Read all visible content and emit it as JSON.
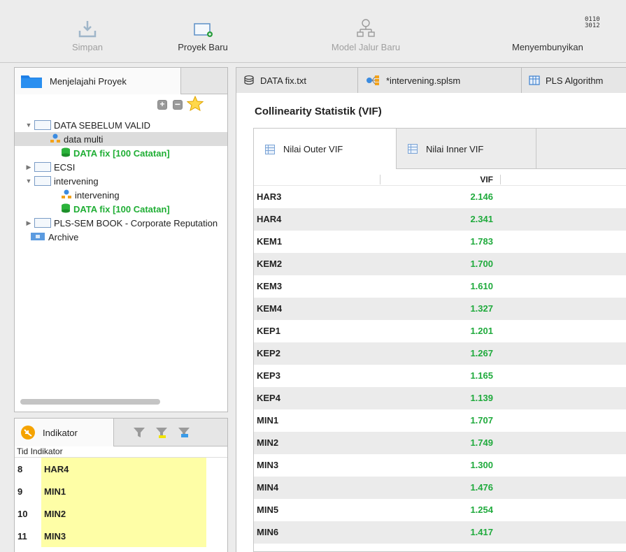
{
  "toolbar": {
    "save_label": "Simpan",
    "new_project_label": "Proyek Baru",
    "new_path_model_label": "Model Jalur Baru",
    "hide_label": "Menyembunyikan",
    "hide_icon_text_line1": "0110",
    "hide_icon_text_line2": "3012"
  },
  "project_explorer": {
    "tab_label": "Menjelajahi Proyek",
    "tree": [
      {
        "label": "DATA SEBELUM VALID",
        "type": "folder",
        "expanded": true
      },
      {
        "label": "data multi",
        "type": "model"
      },
      {
        "label": "DATA fix [100 Catatan]",
        "type": "data"
      },
      {
        "label": "ECSI",
        "type": "folder",
        "expanded": false
      },
      {
        "label": "intervening",
        "type": "folder",
        "expanded": true
      },
      {
        "label": "intervening",
        "type": "model"
      },
      {
        "label": "DATA fix [100 Catatan]",
        "type": "data"
      },
      {
        "label": "PLS-SEM BOOK - Corporate Reputation",
        "type": "folder",
        "expanded": false
      },
      {
        "label": "Archive",
        "type": "archive"
      }
    ]
  },
  "indicator_panel": {
    "tab_label": "Indikator",
    "columns": [
      "Tid",
      "Indikator"
    ],
    "rows": [
      {
        "tid": "8",
        "name": "HAR4"
      },
      {
        "tid": "9",
        "name": "MIN1"
      },
      {
        "tid": "10",
        "name": "MIN2"
      },
      {
        "tid": "11",
        "name": "MIN3"
      }
    ]
  },
  "editor_tabs": [
    {
      "label": "DATA fix.txt"
    },
    {
      "label": "*intervening.splsm"
    },
    {
      "label": "PLS Algorithm"
    }
  ],
  "content": {
    "title": "Collinearity Statistik (VIF)",
    "sub_tabs": [
      {
        "label": "Nilai Outer VIF",
        "active": true
      },
      {
        "label": "Nilai Inner VIF",
        "active": false
      }
    ],
    "column_header": "VIF",
    "value_color": "#1faa3c",
    "rows": [
      {
        "name": "HAR3",
        "vif": "2.146"
      },
      {
        "name": "HAR4",
        "vif": "2.341"
      },
      {
        "name": "KEM1",
        "vif": "1.783"
      },
      {
        "name": "KEM2",
        "vif": "1.700"
      },
      {
        "name": "KEM3",
        "vif": "1.610"
      },
      {
        "name": "KEM4",
        "vif": "1.327"
      },
      {
        "name": "KEP1",
        "vif": "1.201"
      },
      {
        "name": "KEP2",
        "vif": "1.267"
      },
      {
        "name": "KEP3",
        "vif": "1.165"
      },
      {
        "name": "KEP4",
        "vif": "1.139"
      },
      {
        "name": "MIN1",
        "vif": "1.707"
      },
      {
        "name": "MIN2",
        "vif": "1.749"
      },
      {
        "name": "MIN3",
        "vif": "1.300"
      },
      {
        "name": "MIN4",
        "vif": "1.476"
      },
      {
        "name": "MIN5",
        "vif": "1.254"
      },
      {
        "name": "MIN6",
        "vif": "1.417"
      }
    ]
  }
}
